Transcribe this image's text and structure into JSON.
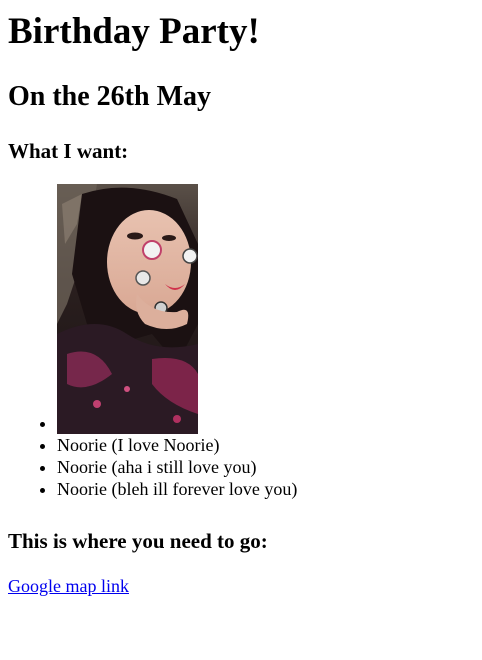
{
  "page": {
    "title": "Birthday Party!",
    "date_heading": "On the 26th May",
    "want_heading": "What I want:",
    "wishlist": [
      {
        "type": "image",
        "icon": "portrait-photo-icon"
      },
      {
        "type": "text",
        "label": "Noorie (I love Noorie)"
      },
      {
        "type": "text",
        "label": "Noorie (aha i still love you)"
      },
      {
        "type": "text",
        "label": "Noorie (bleh ill forever love you)"
      }
    ],
    "location_heading": "This is where you need to go:",
    "map_link_label": "Google map link"
  },
  "colors": {
    "link": "#0000ee",
    "text": "#000000",
    "background": "#ffffff"
  }
}
